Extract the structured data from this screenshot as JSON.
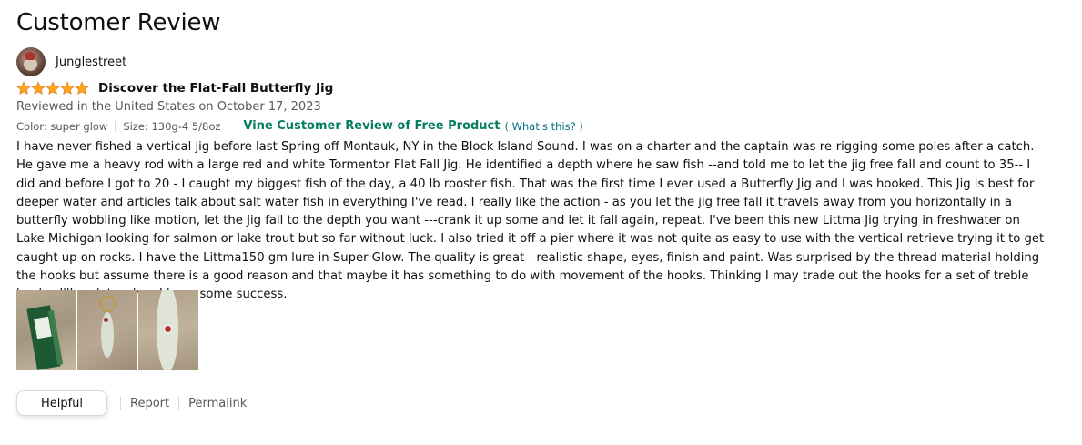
{
  "page": {
    "title": "Customer Review"
  },
  "author": {
    "name": "Junglestreet"
  },
  "review": {
    "rating": 5,
    "rating_max": 5,
    "title": "Discover the Flat-Fall Butterfly Jig",
    "reviewed_in": "Reviewed in the United States on October 17, 2023",
    "color": "Color: super glow",
    "size": "Size: 130g-4 5/8oz",
    "vine_label": "Vine Customer Review of Free Product",
    "whats_this_open": "(",
    "whats_this": "What's this?",
    "whats_this_close": ")",
    "body": "I have never fished a vertical jig before last Spring off Montauk, NY in the Block Island Sound. I was on a charter and the captain was re-rigging some poles after a catch. He gave me a heavy rod with a large red and white Tormentor Flat Fall Jig. He identified a depth where he saw fish --and told me to let the jig free fall and count to 35-- I did and before I got to 20 - I caught my biggest fish of the day, a 40 lb rooster fish. That was the first time I ever used a Butterfly Jig and I was hooked. This Jig is best for deeper water and articles talk about salt water fish in everything I've read. I really like the action - as you let the jig free fall it travels away from you horizontally in a butterfly wobbling like motion, let the Jig fall to the depth you want ---crank it up some and let it fall again, repeat. I've been this new Littma Jig trying in freshwater on Lake Michigan looking for salmon or lake trout but so far without luck. I also tried it off a pier where it was not quite as easy to use with the vertical retrieve trying it to get caught up on rocks. I have the Littma150 gm lure in Super Glow. The quality is great - realistic shape, eyes, finish and paint. Was surprised by the thread material holding the hooks but assume there is a good reason and that maybe it has something to do with movement of the hooks. Thinking I may trade out the hooks for a set of treble hooks. I'll update when I have some success."
  },
  "actions": {
    "helpful": "Helpful",
    "report": "Report",
    "permalink": "Permalink"
  },
  "colors": {
    "star": "#ffa41c",
    "vine": "#067d62",
    "link": "#007185",
    "muted": "#565959"
  },
  "icons": {
    "rating": "star-icon",
    "avatar": "user-avatar"
  }
}
